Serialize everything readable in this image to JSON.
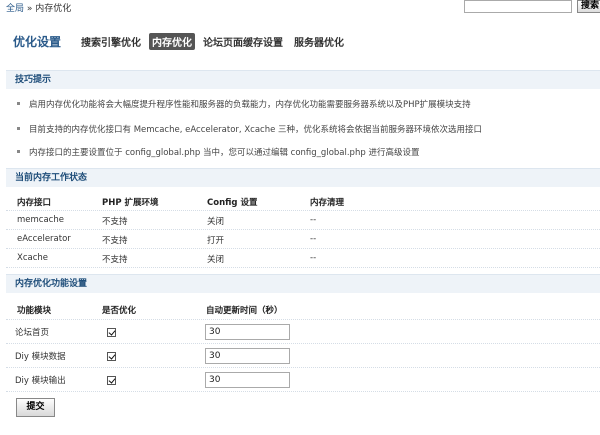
{
  "breadcrumb": {
    "home": "全局",
    "sep": "»",
    "current": "内存优化"
  },
  "search": {
    "value": "",
    "button": "搜索"
  },
  "header": {
    "title": "优化设置",
    "tabs": [
      {
        "label": "搜索引擎优化",
        "active": false
      },
      {
        "label": "内存优化",
        "active": true
      },
      {
        "label": "论坛页面缓存设置",
        "active": false
      },
      {
        "label": "服务器优化",
        "active": false
      }
    ]
  },
  "tips": {
    "title": "技巧提示",
    "items": [
      "启用内存优化功能将会大幅度提升程序性能和服务器的负载能力，内存优化功能需要服务器系统以及PHP扩展模块支持",
      "目前支持的内存优化接口有 Memcache, eAccelerator, Xcache 三种，优化系统将会依据当前服务器环境依次选用接口",
      "内存接口的主要设置位于 config_global.php 当中，您可以通过编辑 config_global.php 进行高级设置"
    ]
  },
  "status": {
    "title": "当前内存工作状态",
    "headers": [
      "内存接口",
      "PHP 扩展环境",
      "Config 设置",
      "内存清理"
    ],
    "rows": [
      [
        "memcache",
        "不支持",
        "关闭",
        "--"
      ],
      [
        "eAccelerator",
        "不支持",
        "打开",
        "--"
      ],
      [
        "Xcache",
        "不支持",
        "关闭",
        "--"
      ]
    ]
  },
  "settings": {
    "title": "内存优化功能设置",
    "headers": [
      "功能模块",
      "是否优化",
      "自动更新时间（秒）"
    ],
    "rows": [
      {
        "module": "论坛首页",
        "checked": true,
        "value": "30"
      },
      {
        "module": "Diy 模块数据",
        "checked": true,
        "value": "30"
      },
      {
        "module": "Diy 模块输出",
        "checked": true,
        "value": "30"
      }
    ]
  },
  "submit_label": "提交"
}
